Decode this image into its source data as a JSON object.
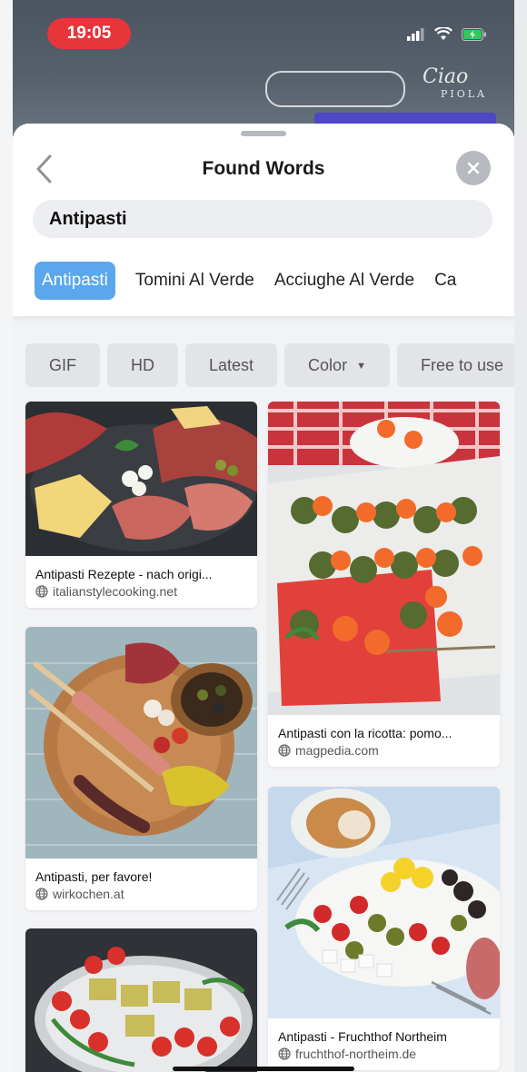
{
  "status": {
    "time": "19:05"
  },
  "header": {
    "title": "Found Words",
    "search_value": "Antipasti",
    "background_logo_line1": "Ciao",
    "background_logo_line2": "PIOLA"
  },
  "words": [
    "Antipasti",
    "Tomini Al Verde",
    "Acciughe Al Verde",
    "Ca"
  ],
  "filters": [
    "GIF",
    "HD",
    "Latest",
    "Color",
    "Free to use"
  ],
  "results": [
    {
      "caption": "Antipasti Rezepte - nach origi...",
      "source": "italianstylecooking.net"
    },
    {
      "caption": "Antipasti con la ricotta: pomo...",
      "source": "magpedia.com"
    },
    {
      "caption": "Antipasti, per favore!",
      "source": "wirkochen.at"
    },
    {
      "caption": "Antipasti - Fruchthof Northeim",
      "source": "fruchthof-northeim.de"
    }
  ],
  "colors": {
    "accent": "#5aa7ee",
    "time_pill": "#e8353a"
  }
}
